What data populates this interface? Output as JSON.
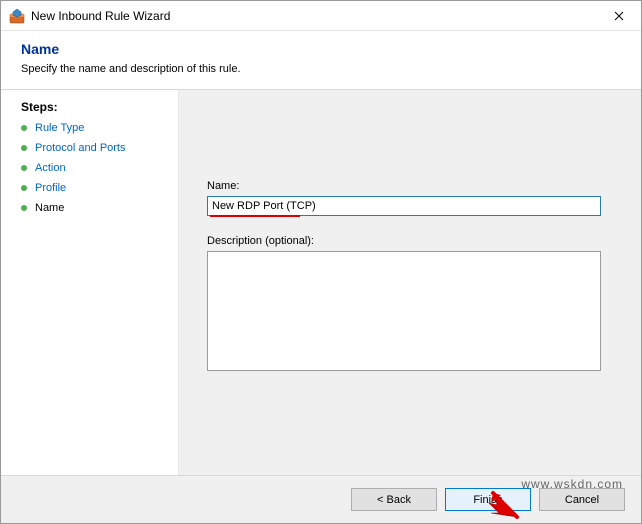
{
  "window": {
    "title": "New Inbound Rule Wizard"
  },
  "header": {
    "title": "Name",
    "subtitle": "Specify the name and description of this rule."
  },
  "sidebar": {
    "steps_label": "Steps:",
    "steps": [
      {
        "label": "Rule Type"
      },
      {
        "label": "Protocol and Ports"
      },
      {
        "label": "Action"
      },
      {
        "label": "Profile"
      },
      {
        "label": "Name"
      }
    ]
  },
  "main": {
    "name_label": "Name:",
    "name_value": "New RDP Port (TCP)",
    "desc_label": "Description (optional):",
    "desc_value": ""
  },
  "footer": {
    "back": "< Back",
    "finish": "Finish",
    "cancel": "Cancel"
  },
  "watermark": "www.wskdn.com"
}
